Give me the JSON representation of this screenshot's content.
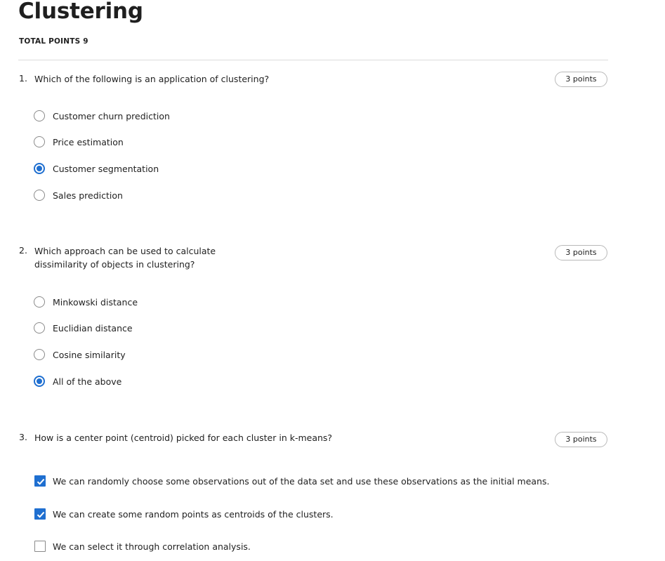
{
  "page": {
    "title": "Clustering",
    "total_points": "TOTAL POINTS 9"
  },
  "questions": [
    {
      "number": "1.",
      "text": "Which of the following is an application of clustering?",
      "points": "3 points",
      "type": "radio",
      "options": [
        {
          "label": "Customer churn prediction",
          "selected": false
        },
        {
          "label": "Price estimation",
          "selected": false
        },
        {
          "label": "Customer segmentation",
          "selected": true
        },
        {
          "label": "Sales prediction",
          "selected": false
        }
      ]
    },
    {
      "number": "2.",
      "text_line1": "Which approach can be used to calculate",
      "text_line2": "dissimilarity of objects in clustering?",
      "points": "3 points",
      "type": "radio",
      "options": [
        {
          "label": "Minkowski distance",
          "selected": false
        },
        {
          "label": "Euclidian distance",
          "selected": false
        },
        {
          "label": "Cosine similarity",
          "selected": false
        },
        {
          "label": "All of the above",
          "selected": true
        }
      ]
    },
    {
      "number": "3.",
      "text": "How is a center point (centroid) picked for each cluster in k-means?",
      "points": "3 points",
      "type": "checkbox",
      "options": [
        {
          "label": "We can randomly choose some observations out of the data set and use these observations as the initial means.",
          "selected": true
        },
        {
          "label": "We can create some random points as centroids of the clusters.",
          "selected": true
        },
        {
          "label": "We can select it through correlation analysis.",
          "selected": false
        }
      ]
    }
  ],
  "colors": {
    "accent": "#1f6fd0",
    "text": "#1f1f1f",
    "border": "#8a8a8a"
  }
}
